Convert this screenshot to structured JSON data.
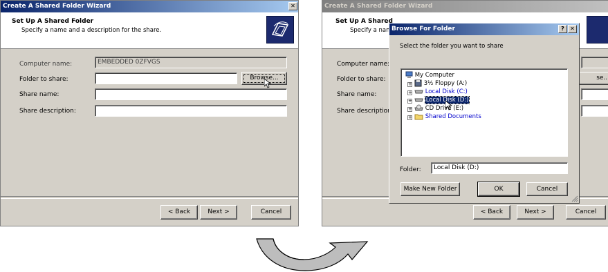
{
  "left_dialog": {
    "title": "Create A Shared Folder Wizard",
    "close_label": "✕",
    "header": {
      "title": "Set Up A Shared Folder",
      "subtitle": "Specify a name and a description for the share."
    },
    "fields": {
      "computer_name_label": "Computer name:",
      "computer_name_value": "EMBEDDED 0ZFVGS",
      "folder_label": "Folder to share:",
      "folder_value": "",
      "share_name_label": "Share name:",
      "share_name_value": "",
      "share_desc_label": "Share description:",
      "share_desc_value": ""
    },
    "browse_label": "Browse...",
    "buttons": {
      "back": "< Back",
      "next": "Next >",
      "cancel": "Cancel"
    }
  },
  "right_dialog": {
    "title": "Create A Shared Folder Wizard",
    "header": {
      "title": "Set Up A Shared",
      "subtitle": "Specify a nam"
    },
    "fields": {
      "computer_name_label": "Computer name:",
      "folder_label": "Folder to share:",
      "share_name_label": "Share name:",
      "share_desc_label": "Share description:"
    },
    "browse_partial": "se...",
    "buttons": {
      "back": "< Back",
      "next": "Next >",
      "cancel": "Cancel"
    }
  },
  "browse_dialog": {
    "title": "Browse For Folder",
    "help_label": "?",
    "close_label": "✕",
    "instruction": "Select the folder you want to share",
    "tree": [
      {
        "label": "My Computer",
        "icon": "computer-icon"
      },
      {
        "label": "3½ Floppy (A:)",
        "icon": "floppy-icon"
      },
      {
        "label": "Local Disk (C:)",
        "icon": "drive-icon"
      },
      {
        "label": "Local Disk (D:)",
        "icon": "drive-icon"
      },
      {
        "label": "CD Drive (E:)",
        "icon": "cd-drive-icon"
      },
      {
        "label": "Shared Documents",
        "icon": "folder-icon"
      }
    ],
    "folder_label": "Folder:",
    "folder_value": "Local Disk (D:)",
    "buttons": {
      "make_new_folder": "Make New Folder",
      "ok": "OK",
      "cancel": "Cancel"
    }
  },
  "colors": {
    "window_bg": "#d4d0c8",
    "title_active": "#0a246a",
    "title_inactive": "#808080",
    "selection": "#0a246a",
    "link_blue": "#0000cc"
  }
}
